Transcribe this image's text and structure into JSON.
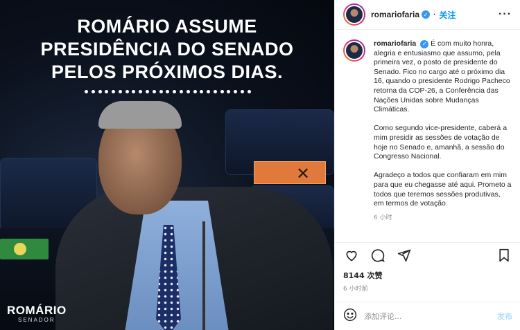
{
  "media": {
    "headline": [
      "ROMÁRIO ASSUME",
      "PRESIDÊNCIA DO SENADO",
      "PELOS PRÓXIMOS DIAS."
    ],
    "brand_name": "ROMÁRIO",
    "brand_sub": "SENADOR"
  },
  "header": {
    "username": "romariofaria",
    "follow_label": "关注",
    "more_icon": "more-horizontal-icon"
  },
  "caption": {
    "username": "romariofaria",
    "paragraphs": [
      "É com muito honra, alegria e entusiasmo que assumo, pela primeira vez, o posto de presidente do Senado. Fico no cargo até o próximo dia 16, quando o presidente Rodrigo Pacheco retorna da COP-26, a Conferência das Nações Unidas sobre Mudanças Climáticas.",
      "Como segundo vice-presidente, caberá a mim presidir as sessões de votação de hoje no Senado e, amanhã, a sessão do Congresso Nacional.",
      "Agradeço a todos que confiaram em mim para que eu chegasse até aqui. Prometo a todos que teremos sessões produtivas, em termos de votação."
    ],
    "time": "6 小时"
  },
  "actions": {
    "icons": [
      "heart-icon",
      "comment-icon",
      "share-icon",
      "bookmark-icon"
    ]
  },
  "likes": "8144 次赞",
  "posted_time": "6 小时前",
  "comment_box": {
    "placeholder": "添加评论...",
    "post_label": "发布",
    "emoji_icon": "emoji-icon"
  },
  "colors": {
    "accent_blue": "#0095f6",
    "verified_blue": "#3897f0",
    "post_disabled": "#b2dffc"
  }
}
